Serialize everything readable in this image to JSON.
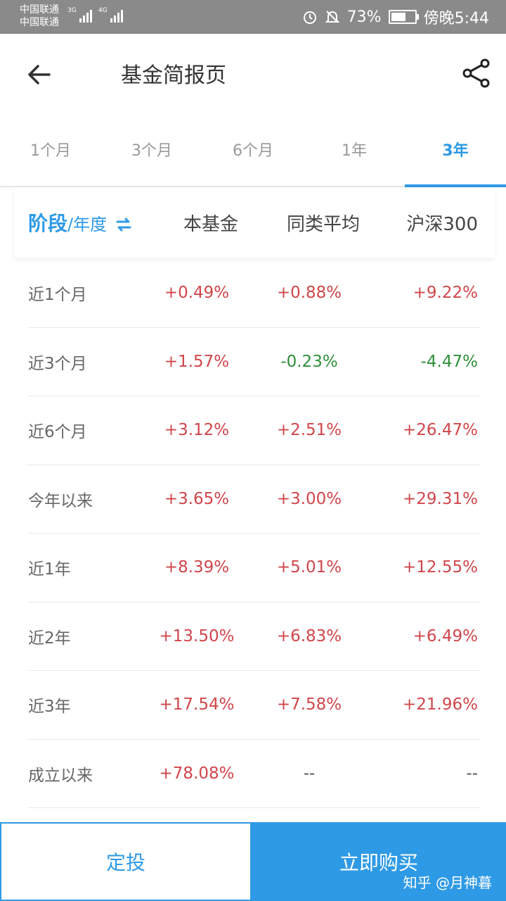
{
  "status_bar": {
    "carrier_1": "中国联通",
    "carrier_2": "中国联通",
    "net_1": "3G",
    "net_2": "4G",
    "battery": "73%",
    "time": "傍晚5:44",
    "battery_level": 0.73,
    "icons": [
      "alarm-icon",
      "mute-bell-icon",
      "battery-icon"
    ]
  },
  "header": {
    "title": "基金简报页",
    "back_icon": "arrow-left-icon",
    "share_icon": "share-icon"
  },
  "tabs": [
    {
      "label": "1个月",
      "active": false
    },
    {
      "label": "3个月",
      "active": false
    },
    {
      "label": "6个月",
      "active": false
    },
    {
      "label": "1年",
      "active": false
    },
    {
      "label": "3年",
      "active": true
    }
  ],
  "table": {
    "stage_label": "阶段",
    "year_label": "/年度",
    "columns": [
      "本基金",
      "同类平均",
      "沪深300"
    ],
    "rows": [
      {
        "label": "近1个月",
        "values": [
          "+0.49%",
          "+0.88%",
          "+9.22%"
        ]
      },
      {
        "label": "近3个月",
        "values": [
          "+1.57%",
          "-0.23%",
          "-4.47%"
        ]
      },
      {
        "label": "近6个月",
        "values": [
          "+3.12%",
          "+2.51%",
          "+26.47%"
        ]
      },
      {
        "label": "今年以来",
        "values": [
          "+3.65%",
          "+3.00%",
          "+29.31%"
        ]
      },
      {
        "label": "近1年",
        "values": [
          "+8.39%",
          "+5.01%",
          "+12.55%"
        ]
      },
      {
        "label": "近2年",
        "values": [
          "+13.50%",
          "+6.83%",
          "+6.49%"
        ]
      },
      {
        "label": "近3年",
        "values": [
          "+17.54%",
          "+7.58%",
          "+21.96%"
        ]
      },
      {
        "label": "成立以来",
        "values": [
          "+78.08%",
          "--",
          "--"
        ]
      }
    ]
  },
  "bottom_bar": {
    "sip_label": "定投",
    "buy_label": "立即购买"
  },
  "watermark": "知乎 @月神暮",
  "colors": {
    "accent": "#2e9ae6",
    "positive": "#d0464b",
    "negative": "#2f8f3a"
  }
}
